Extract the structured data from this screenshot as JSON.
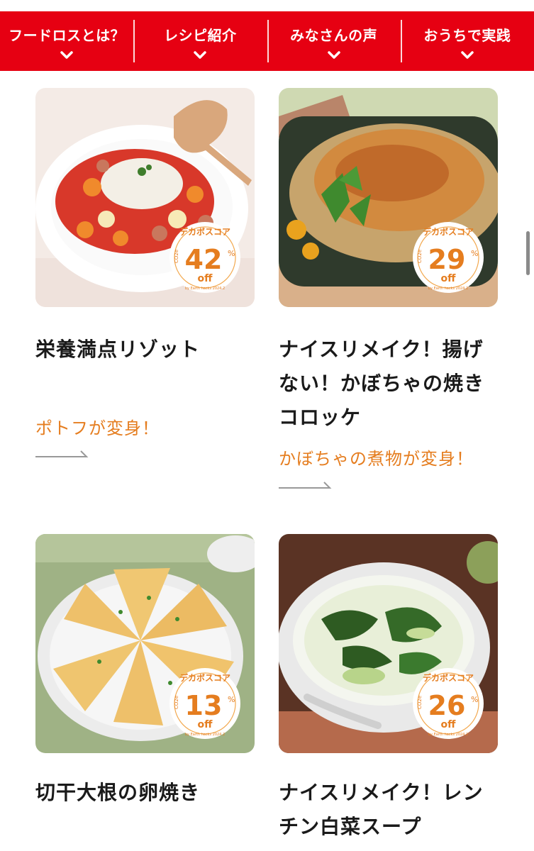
{
  "nav": {
    "items": [
      {
        "label": "フードロスとは？"
      },
      {
        "label": "レシピ紹介"
      },
      {
        "label": "みなさんの声"
      },
      {
        "label": "おうちで実践"
      }
    ],
    "bg_color": "#e60012"
  },
  "badge": {
    "title": "デカボスコア",
    "co2": "CO2e",
    "percent": "%",
    "off": "off",
    "credit": "by Earth hacks 2024.2"
  },
  "recipes": [
    {
      "title": "栄養満点リゾット",
      "subtitle": "ポトフが変身！",
      "score": "42"
    },
    {
      "title": "ナイスリメイク！揚げない！かぼちゃの焼きコロッケ",
      "subtitle": "かぼちゃの煮物が変身！",
      "score": "29"
    },
    {
      "title": "切干大根の卵焼き",
      "subtitle": "",
      "score": "13"
    },
    {
      "title": "ナイスリメイク！レンチン白菜スープ",
      "subtitle": "",
      "score": "26"
    }
  ],
  "colors": {
    "accent_orange": "#e57d1f",
    "nav_red": "#e60012"
  }
}
